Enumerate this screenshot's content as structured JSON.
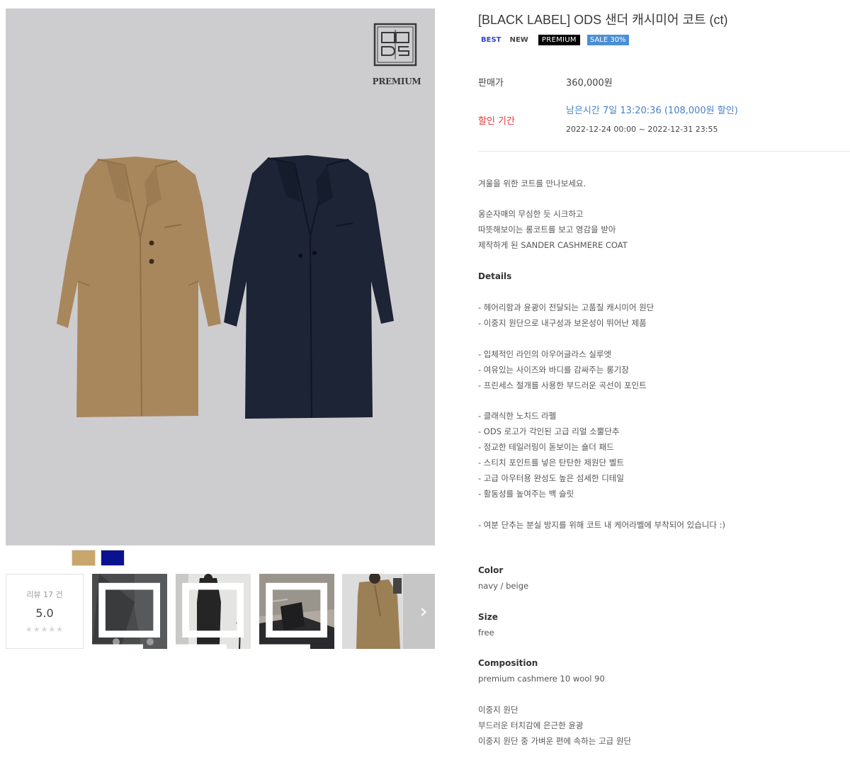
{
  "brand": {
    "logo_text": "ODS",
    "sub_label": "PREMIUM"
  },
  "product": {
    "title": "[BLACK LABEL] ODS 샌더 캐시미어 코트 (ct)",
    "badges": {
      "best": "BEST",
      "new": "NEW",
      "premium": "PREMIUM",
      "sale": "SALE 30%"
    },
    "price_label": "판매가",
    "price_value": "360,000원",
    "sale_label": "할인 기간",
    "sale_remaining": "남은시간 7일 13:20:36 (108,000원 할인)",
    "sale_period": "2022-12-24 00:00 ~ 2022-12-31 23:55"
  },
  "swatches": [
    {
      "name": "beige",
      "color": "#c9a66b"
    },
    {
      "name": "navy",
      "color": "#0a128f"
    }
  ],
  "review": {
    "count_label": "리뷰 17 건",
    "score": "5.0",
    "stars": "★★★★★"
  },
  "thumbnail_icon": "multi-image-icon",
  "next_icon": "chevron-right-icon",
  "next_glyph": "›",
  "description": {
    "intro": "겨울을 위한 코트를 만나보세요.",
    "story": [
      "옹순자매의 무심한 듯 시크하고",
      "따뜻해보이는 롱코트를 보고 영감을 받아",
      "제작하게 된 SANDER CASHMERE COAT"
    ],
    "details_heading": "Details",
    "details_group1": [
      "- 헤어리함과 윤광이 전달되는 고품질 캐시미어 원단",
      "- 이중지 원단으로 내구성과 보온성이 뛰어난 제품"
    ],
    "details_group2": [
      "- 입체적인 라인의 아우어글라스 실루엣",
      "- 여유있는 사이즈와 바디를 감싸주는 롱기장",
      "- 프린세스 절개를 사용한 부드러운 곡선이 포인트"
    ],
    "details_group3": [
      "- 클래식한 노치드 라펠",
      "- ODS 로고가 각인된 고급 리얼 소뿔단추",
      "- 정교한 테일러링이 돋보이는 숄더 패드",
      "- 스티치 포인트를 넣은 탄탄한 제원단 벨트",
      "- 고급 아우터용 완성도 높은 섬세한 디테일",
      "- 활동성를 높여주는 백 슬릿"
    ],
    "details_note": "- 여분 단추는 분실 방지를 위해 코트 내 케어라벨에 부착되어 있습니다 :)",
    "color_heading": "Color",
    "color_value": "navy / beige",
    "size_heading": "Size",
    "size_value": "free",
    "composition_heading": "Composition",
    "composition_value": "premium cashmere 10 wool 90",
    "fabric_notes": [
      "이중지 원단",
      "부드러운 터치감에 은근한 윤광",
      "이중지 원단 중 가벼운 편에 속하는 고급 원단"
    ]
  }
}
